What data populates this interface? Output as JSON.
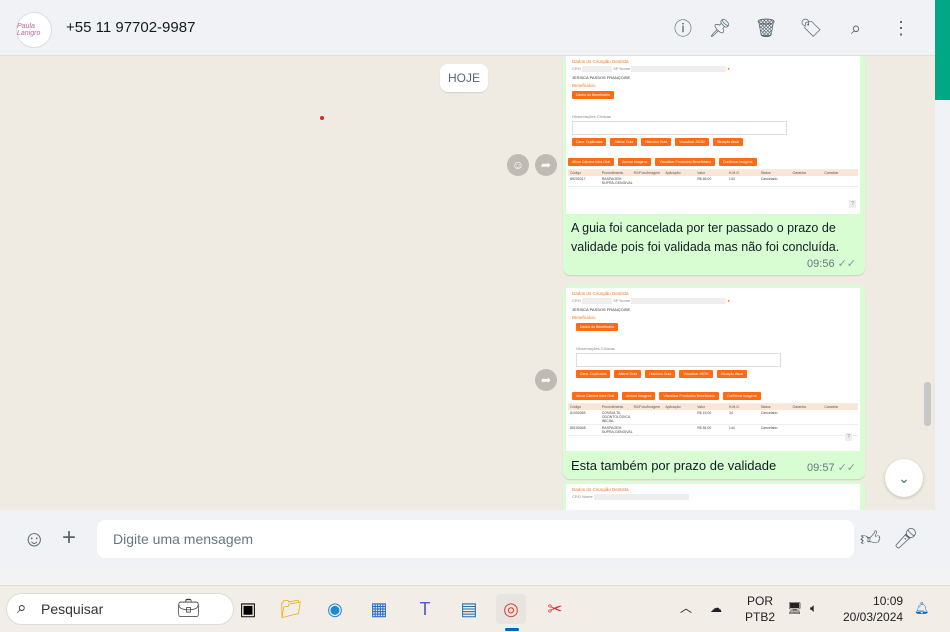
{
  "header": {
    "contact": "+55 11 97702-9987",
    "avatar_text": "Paula Lanigro"
  },
  "chat": {
    "date_badge": "HOJE",
    "messages": [
      {
        "caption": "A guia foi cancelada por ter passado o prazo de validade pois foi validada mas não foi concluída.",
        "time": "09:56",
        "status": "read"
      },
      {
        "caption": "Esta também por prazo de validade",
        "time": "09:57",
        "status": "read"
      }
    ],
    "screenshot": {
      "section_dentist": "Dados do Cirurgião Dentista",
      "cro_label": "CRO",
      "name_label": "Nome",
      "uf": "SP",
      "dentist_name": "JESSICA PASSOS FRANÇOISE",
      "section_beneficiary": "Beneficiário",
      "btn_beneficiary": "Dados do Beneficiário",
      "obs_label": "Observações Clínicas",
      "buttons": [
        "Canc. Duplicatas",
        "Alterar Guia",
        "Histórico Guia",
        "Visualizar JSON",
        "Situação Atual"
      ],
      "buttons2": [
        "Ativar Câmera Intra Oral",
        "Anexar Imagens",
        "Visualizar Prontuário Beneficiário",
        "Confirmar imagens"
      ],
      "columns": [
        "Código",
        "Procedimento",
        "RX/Foto/Imagem",
        "Aplicação",
        "Valor",
        "H.M.G.",
        "Status",
        "Garantia",
        "Cancelar"
      ],
      "rows1": [
        [
          "85200017",
          "RASPAGEM SUPRA-GENGIVAL",
          "",
          "",
          "R$ 65,00",
          "134",
          "Cancelado",
          "",
          ""
        ]
      ],
      "rows2": [
        [
          "81000065",
          "CONSULTA ODONTOLÓGICA INICIAL",
          "",
          "",
          "R$ 15,00",
          "34",
          "Cancelado",
          "",
          ""
        ],
        [
          "85100048",
          "RASPAGEM SUPRA-GENGIVAL",
          "",
          "",
          "R$ 84,00",
          "144",
          "Cancelado",
          "",
          ""
        ]
      ],
      "help": "?"
    }
  },
  "footer": {
    "placeholder": "Digite uma mensagem"
  },
  "taskbar": {
    "search": "Pesquisar",
    "lang1": "POR",
    "lang2": "PTB2",
    "time": "10:09",
    "date": "20/03/2024"
  }
}
